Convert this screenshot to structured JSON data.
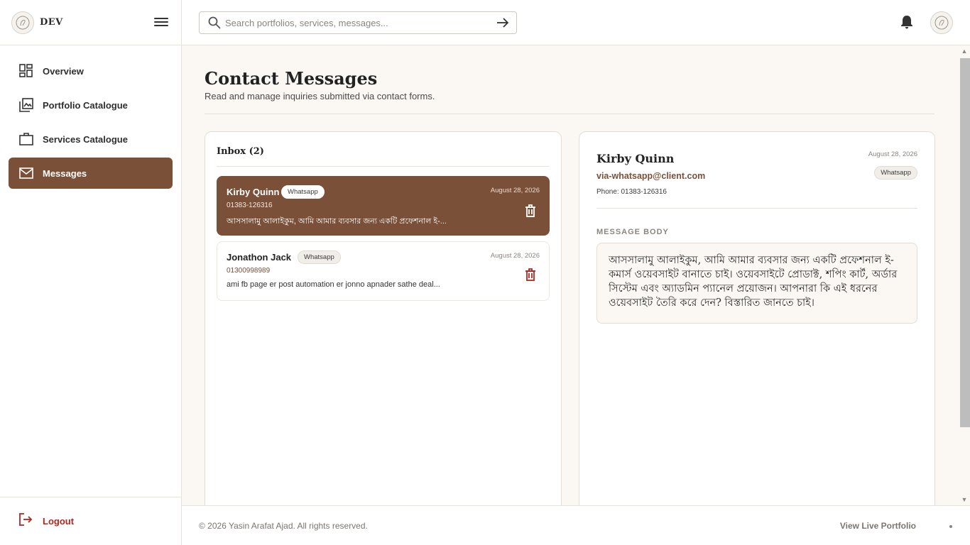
{
  "brand": {
    "name": "DEV"
  },
  "sidebar": {
    "items": [
      {
        "label": "Overview",
        "icon": "dashboard-icon"
      },
      {
        "label": "Portfolio Catalogue",
        "icon": "gallery-icon"
      },
      {
        "label": "Services Catalogue",
        "icon": "briefcase-icon"
      },
      {
        "label": "Messages",
        "icon": "mail-icon",
        "active": true
      }
    ],
    "logout_label": "Logout"
  },
  "search": {
    "placeholder": "Search portfolios, services, messages..."
  },
  "page": {
    "title": "Contact Messages",
    "subtitle": "Read and manage inquiries submitted via contact forms."
  },
  "inbox": {
    "title": "Inbox (2)",
    "messages": [
      {
        "name": "Kirby Quinn",
        "source": "Whatsapp",
        "date": "August 28, 2026",
        "phone": "01383-126316",
        "preview": "আসসালামু আলাইকুম, আমি আমার ব্যবসার জন্য একটি প্রফেশনাল ই-...",
        "selected": true
      },
      {
        "name": "Jonathon Jack",
        "source": "Whatsapp",
        "date": "August 28, 2026",
        "phone": "01300998989",
        "preview": "ami fb page er post automation er jonno apnader sathe deal...",
        "selected": false
      }
    ]
  },
  "detail": {
    "name": "Kirby Quinn",
    "date": "August 28, 2026",
    "source": "Whatsapp",
    "email": "via-whatsapp@client.com",
    "phone": "Phone: 01383-126316",
    "body_label": "MESSAGE BODY",
    "body": "আসসালামু আলাইকুম, আমি আমার ব্যবসার জন্য একটি প্রফেশনাল ই-কমার্স ওয়েবসাইট বানাতে চাই। ওয়েবসাইটে প্রোডাক্ট, শপিং কার্ট, অর্ডার সিস্টেম এবং অ্যাডমিন প্যানেল প্রয়োজন। আপনারা কি এই ধরনের ওয়েবসাইট তৈরি করে দেন? বিস্তারিত জানতে চাই।"
  },
  "footer": {
    "copyright": "© 2026 Yasin Arafat Ajad. All rights reserved.",
    "live_link": "View Live Portfolio"
  },
  "colors": {
    "accent": "#7b5039",
    "danger": "#b3261e",
    "background": "#fbf8f3"
  }
}
